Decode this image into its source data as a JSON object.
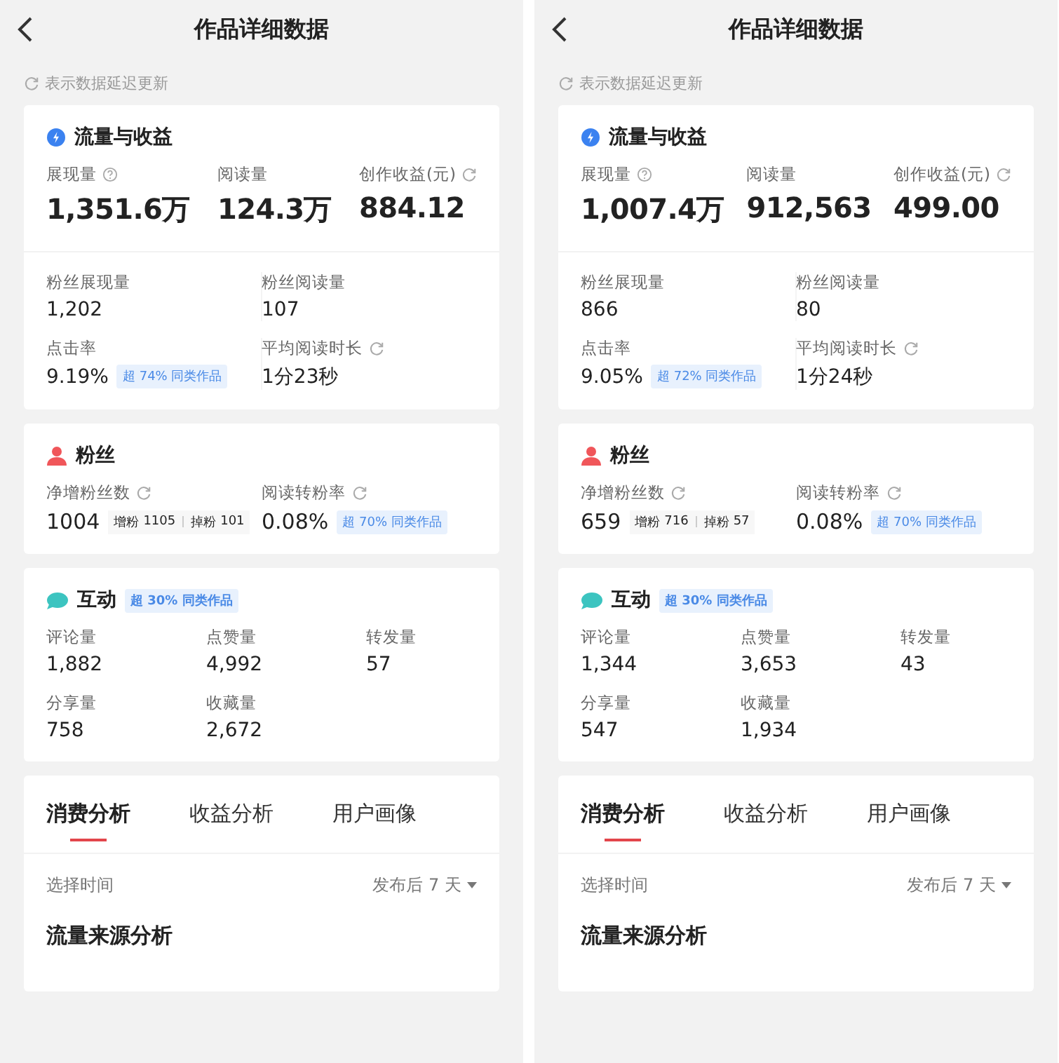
{
  "screens": [
    {
      "header": {
        "title": "作品详细数据"
      },
      "note": "表示数据延迟更新",
      "traffic": {
        "title": "流量与收益",
        "metrics": [
          {
            "label": "展现量",
            "kind": "help",
            "value": "1,351.6万"
          },
          {
            "label": "阅读量",
            "kind": "plain",
            "value": "124.3万"
          },
          {
            "label": "创作收益(元)",
            "kind": "delayed",
            "value": "884.12"
          }
        ],
        "details": [
          {
            "label": "粉丝展现量",
            "kind": "plain",
            "value": "1,202"
          },
          {
            "label": "粉丝阅读量",
            "kind": "plain",
            "value": "107"
          },
          {
            "label": "点击率",
            "kind": "plain",
            "value": "9.19%",
            "badge": "超 74% 同类作品"
          },
          {
            "label": "平均阅读时长",
            "kind": "delayed",
            "value": "1分23秒"
          }
        ]
      },
      "fans": {
        "title": "粉丝",
        "net": {
          "label": "净增粉丝数",
          "kind": "delayed",
          "value": "1004",
          "gain_label": "增粉",
          "gain": "1105",
          "loss_label": "掉粉",
          "loss": "101"
        },
        "rate": {
          "label": "阅读转粉率",
          "kind": "delayed",
          "value": "0.08%",
          "badge": "超 70% 同类作品"
        }
      },
      "interaction": {
        "title": "互动",
        "badge": "超 30% 同类作品",
        "metrics": [
          {
            "label": "评论量",
            "value": "1,882"
          },
          {
            "label": "点赞量",
            "value": "4,992"
          },
          {
            "label": "转发量",
            "value": "57"
          },
          {
            "label": "分享量",
            "value": "758"
          },
          {
            "label": "收藏量",
            "value": "2,672"
          }
        ]
      },
      "analysis": {
        "tabs": [
          {
            "label": "消费分析",
            "selected": true
          },
          {
            "label": "收益分析",
            "selected": false
          },
          {
            "label": "用户画像",
            "selected": false
          }
        ],
        "time_label": "选择时间",
        "time_value": "发布后 7 天",
        "section_title": "流量来源分析"
      }
    },
    {
      "header": {
        "title": "作品详细数据"
      },
      "note": "表示数据延迟更新",
      "traffic": {
        "title": "流量与收益",
        "metrics": [
          {
            "label": "展现量",
            "kind": "help",
            "value": "1,007.4万"
          },
          {
            "label": "阅读量",
            "kind": "plain",
            "value": "912,563"
          },
          {
            "label": "创作收益(元)",
            "kind": "delayed",
            "value": "499.00"
          }
        ],
        "details": [
          {
            "label": "粉丝展现量",
            "kind": "plain",
            "value": "866"
          },
          {
            "label": "粉丝阅读量",
            "kind": "plain",
            "value": "80"
          },
          {
            "label": "点击率",
            "kind": "plain",
            "value": "9.05%",
            "badge": "超 72% 同类作品"
          },
          {
            "label": "平均阅读时长",
            "kind": "delayed",
            "value": "1分24秒"
          }
        ]
      },
      "fans": {
        "title": "粉丝",
        "net": {
          "label": "净增粉丝数",
          "kind": "delayed",
          "value": "659",
          "gain_label": "增粉",
          "gain": "716",
          "loss_label": "掉粉",
          "loss": "57"
        },
        "rate": {
          "label": "阅读转粉率",
          "kind": "delayed",
          "value": "0.08%",
          "badge": "超 70% 同类作品"
        }
      },
      "interaction": {
        "title": "互动",
        "badge": "超 30% 同类作品",
        "metrics": [
          {
            "label": "评论量",
            "value": "1,344"
          },
          {
            "label": "点赞量",
            "value": "3,653"
          },
          {
            "label": "转发量",
            "value": "43"
          },
          {
            "label": "分享量",
            "value": "547"
          },
          {
            "label": "收藏量",
            "value": "1,934"
          }
        ]
      },
      "analysis": {
        "tabs": [
          {
            "label": "消费分析",
            "selected": true
          },
          {
            "label": "收益分析",
            "selected": false
          },
          {
            "label": "用户画像",
            "selected": false
          }
        ],
        "time_label": "选择时间",
        "time_value": "发布后 7 天",
        "section_title": "流量来源分析"
      }
    }
  ]
}
